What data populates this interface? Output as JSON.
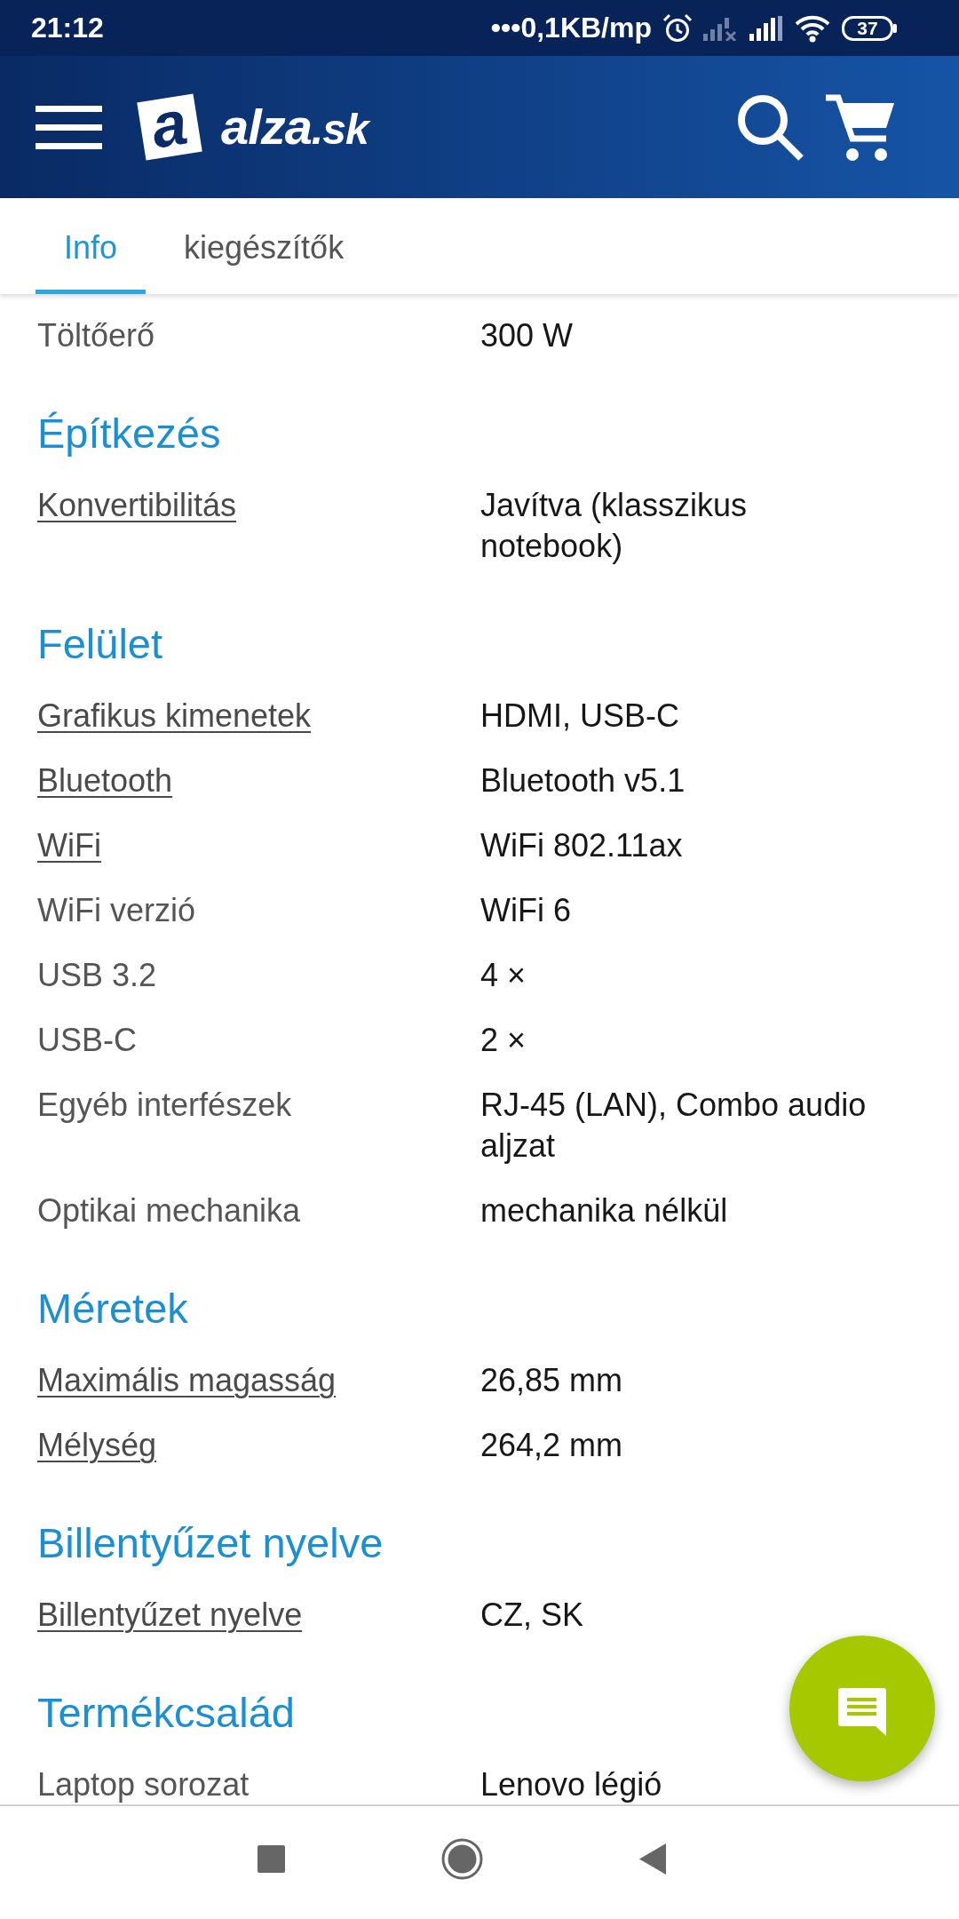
{
  "status_bar": {
    "time": "21:12",
    "network_speed": "•••0,1KB/mp",
    "battery": "37"
  },
  "header": {
    "logo": {
      "mark": "a",
      "name": "alza",
      "domain": ".sk"
    }
  },
  "tabs": [
    {
      "label": "Info",
      "selected": true
    },
    {
      "label": "kiegészítők",
      "selected": false
    }
  ],
  "sections": [
    {
      "rows": [
        {
          "label": "Töltőerő",
          "value": "300 W",
          "link": false
        }
      ]
    },
    {
      "title": "Építkezés",
      "rows": [
        {
          "label": "Konvertibilitás",
          "value": "Javítva (klasszikus notebook)",
          "link": true
        }
      ]
    },
    {
      "title": "Felület",
      "rows": [
        {
          "label": "Grafikus kimenetek",
          "value": "HDMI, USB-C",
          "link": true
        },
        {
          "label": "Bluetooth",
          "value": "Bluetooth v5.1",
          "link": true
        },
        {
          "label": "WiFi",
          "value": "WiFi 802.11ax",
          "link": true
        },
        {
          "label": "WiFi verzió",
          "value": "WiFi 6",
          "link": false
        },
        {
          "label": "USB 3.2",
          "value": "4 ×",
          "link": false
        },
        {
          "label": "USB-C",
          "value": "2 ×",
          "link": false
        },
        {
          "label": "Egyéb interfészek",
          "value": "RJ-45 (LAN), Combo audio aljzat",
          "link": false
        },
        {
          "label": "Optikai mechanika",
          "value": "mechanika nélkül",
          "link": false
        }
      ]
    },
    {
      "title": "Méretek",
      "rows": [
        {
          "label": "Maximális magasság",
          "value": "26,85 mm",
          "link": true
        },
        {
          "label": "Mélység",
          "value": "264,2 mm",
          "link": true
        }
      ]
    },
    {
      "title": "Billentyűzet nyelve",
      "rows": [
        {
          "label": "Billentyűzet nyelve",
          "value": "CZ, SK",
          "link": true
        }
      ]
    },
    {
      "title": "Termékcsalád",
      "rows": [
        {
          "label": "Laptop sorozat",
          "value": "Lenovo légió",
          "link": false
        }
      ]
    }
  ]
}
